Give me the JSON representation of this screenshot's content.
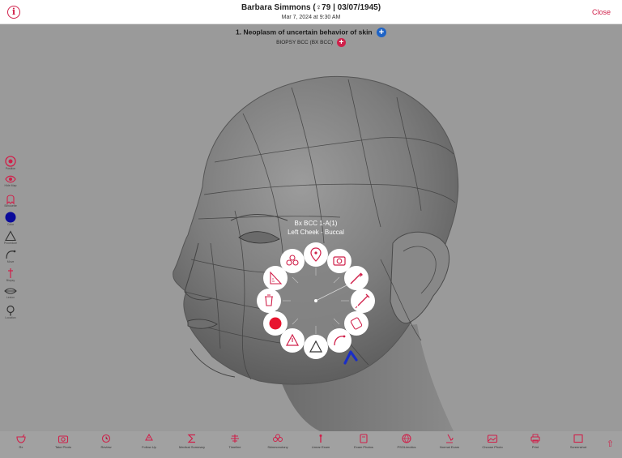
{
  "header": {
    "patient": "Barbara Simmons (♀79 | 03/07/1945)",
    "visit_date": "Mar 7, 2024 at 9:30 AM",
    "close_label": "Close",
    "info_glyph": "i"
  },
  "diagnosis": {
    "title": "1. Neoplasm of uncertain behavior of skin",
    "biopsy": "BIOPSY BCC (BX BCC)"
  },
  "annotation": {
    "label": "Bx BCC 1-A(1)",
    "location": "Left Cheek - Buccal"
  },
  "left_tools": [
    {
      "name": "target",
      "label": "Position"
    },
    {
      "name": "eye",
      "label": "Hide Map"
    },
    {
      "name": "ghost",
      "label": "Silhouette"
    },
    {
      "name": "color",
      "label": "Color"
    },
    {
      "name": "triangle",
      "label": "Procedure"
    },
    {
      "name": "wand",
      "label": "Move"
    },
    {
      "name": "pin",
      "label": "Biopsy"
    },
    {
      "name": "lips",
      "label": "Lesion"
    },
    {
      "name": "magnifier",
      "label": "Location"
    }
  ],
  "bottom_bar": [
    {
      "icon": "rx-icon",
      "label": "Rx"
    },
    {
      "icon": "camera-icon",
      "label": "Take Photo"
    },
    {
      "icon": "review-icon",
      "label": "Review"
    },
    {
      "icon": "recycle-icon",
      "label": "Follow Up"
    },
    {
      "icon": "sigma-icon",
      "label": "Medical Summary"
    },
    {
      "icon": "timeline-icon",
      "label": "Timeline"
    },
    {
      "icon": "microscope-icon",
      "label": "Skinmonotony"
    },
    {
      "icon": "lineart-icon",
      "label": "Linear Exam"
    },
    {
      "icon": "exam-photo-icon",
      "label": "Exam Photos"
    },
    {
      "icon": "globe-icon",
      "label": "PSOLimotics"
    },
    {
      "icon": "microscope-icon",
      "label": "Normal Exam"
    },
    {
      "icon": "gallery-icon",
      "label": "Choose Photo"
    },
    {
      "icon": "print-icon",
      "label": "Print"
    },
    {
      "icon": "screenshot-icon",
      "label": "Screenshot"
    }
  ],
  "colors": {
    "accent": "#d0204a",
    "blue": "#1e63c6",
    "background": "#9a9a9a",
    "selected_color": "#0a0a9a",
    "record": "#e8142e"
  }
}
